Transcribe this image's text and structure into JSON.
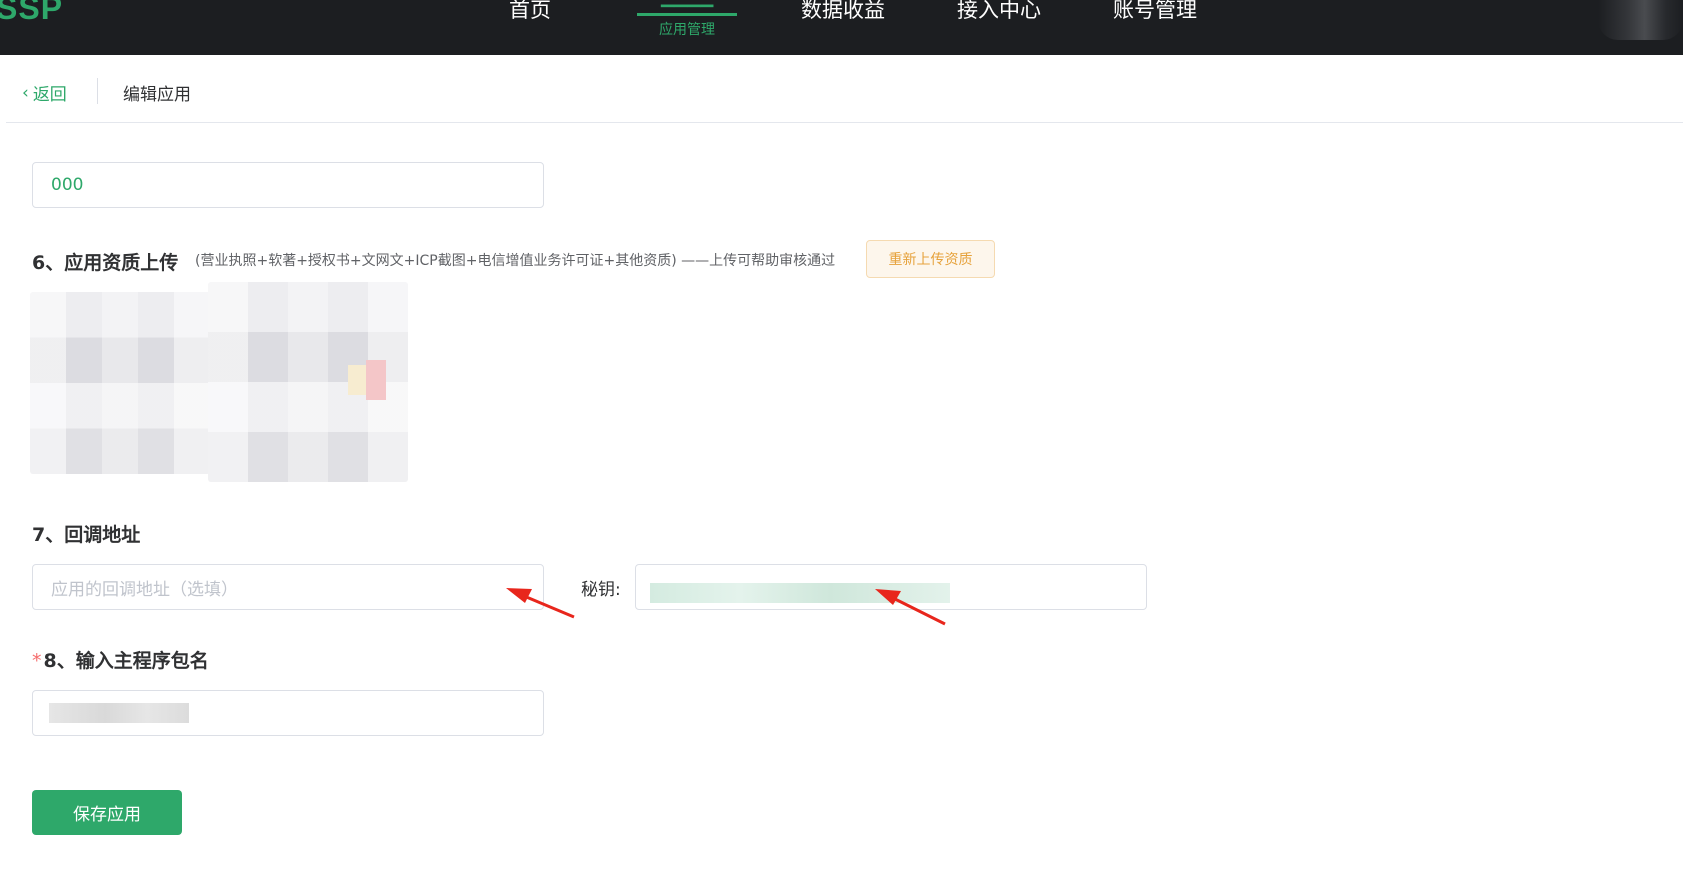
{
  "nav": {
    "logo": "SSP",
    "items": [
      "首页",
      "数据收益",
      "接入中心",
      "账号管理"
    ],
    "active_sub_label": "应用管理"
  },
  "header": {
    "back_label": "返回",
    "title": "编辑应用"
  },
  "form": {
    "prev_field_value": "000",
    "section6": {
      "title": "6、应用资质上传",
      "hint": "(营业执照+软著+授权书+文网文+ICP截图+电信增值业务许可证+其他资质) ——上传可帮助审核通过",
      "reupload_label": "重新上传资质"
    },
    "section7": {
      "title": "7、回调地址",
      "callback_placeholder": "应用的回调地址（选填）",
      "secret_label": "秘钥:"
    },
    "section8": {
      "required_mark": "*",
      "title": "8、输入主程序包名"
    },
    "save_label": "保存应用"
  },
  "colors": {
    "brand": "#2ea86a",
    "nav_bg": "#1c1e21",
    "warning": "#e6a23c",
    "annotation_arrow": "#e8261c"
  }
}
